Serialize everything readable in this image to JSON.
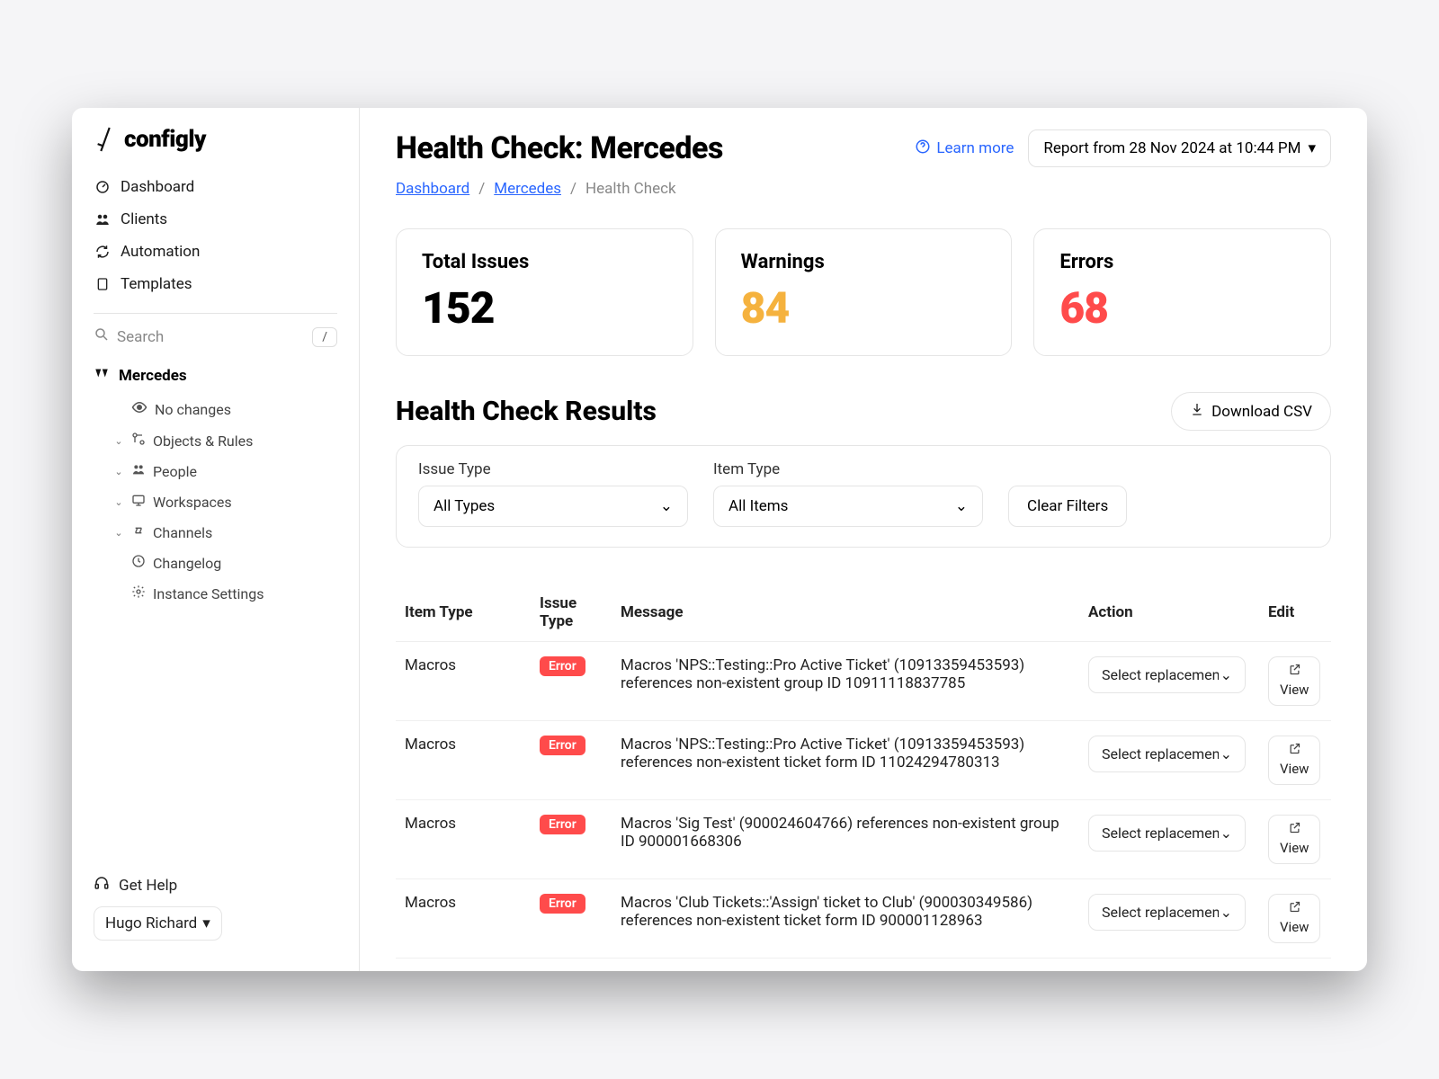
{
  "brand": {
    "name": "configly"
  },
  "sidebar": {
    "nav": [
      {
        "label": "Dashboard"
      },
      {
        "label": "Clients"
      },
      {
        "label": "Automation"
      },
      {
        "label": "Templates"
      }
    ],
    "search_placeholder": "Search",
    "search_kbd": "/",
    "client_name": "Mercedes",
    "tree": [
      {
        "label": "No changes",
        "icon": "eye"
      },
      {
        "label": "Objects & Rules",
        "icon": "objects",
        "expandable": true
      },
      {
        "label": "People",
        "icon": "people",
        "expandable": true
      },
      {
        "label": "Workspaces",
        "icon": "workspace",
        "expandable": true
      },
      {
        "label": "Channels",
        "icon": "channels",
        "expandable": true
      },
      {
        "label": "Changelog",
        "icon": "clock"
      },
      {
        "label": "Instance Settings",
        "icon": "gear"
      }
    ],
    "help_label": "Get Help",
    "user_name": "Hugo Richard"
  },
  "header": {
    "title": "Health Check: Mercedes",
    "learn_more": "Learn more",
    "report_label": "Report from 28 Nov 2024 at 10:44 PM"
  },
  "breadcrumb": {
    "items": [
      "Dashboard",
      "Mercedes",
      "Health Check"
    ]
  },
  "stats": {
    "total_label": "Total Issues",
    "total_value": "152",
    "warnings_label": "Warnings",
    "warnings_value": "84",
    "errors_label": "Errors",
    "errors_value": "68"
  },
  "results": {
    "title": "Health Check Results",
    "download_label": "Download CSV",
    "filter_issue_label": "Issue Type",
    "filter_issue_value": "All Types",
    "filter_item_label": "Item Type",
    "filter_item_value": "All Items",
    "clear_label": "Clear Filters",
    "columns": {
      "item": "Item Type",
      "issue": "Issue Type",
      "message": "Message",
      "action": "Action",
      "edit": "Edit"
    },
    "action_placeholder": "Select replacement",
    "view_label": "View",
    "rows": [
      {
        "item": "Macros",
        "issue": "Error",
        "message": "Macros 'NPS::Testing::Pro Active Ticket' (10913359453593) references non-existent group ID 10911118837785"
      },
      {
        "item": "Macros",
        "issue": "Error",
        "message": "Macros 'NPS::Testing::Pro Active Ticket' (10913359453593) references non-existent ticket form ID 11024294780313"
      },
      {
        "item": "Macros",
        "issue": "Error",
        "message": "Macros 'Sig Test' (900024604766) references non-existent group ID 900001668306"
      },
      {
        "item": "Macros",
        "issue": "Error",
        "message": "Macros 'Club Tickets::'Assign' ticket to Club' (900030349586) references non-existent ticket form ID 900001128963"
      }
    ]
  }
}
